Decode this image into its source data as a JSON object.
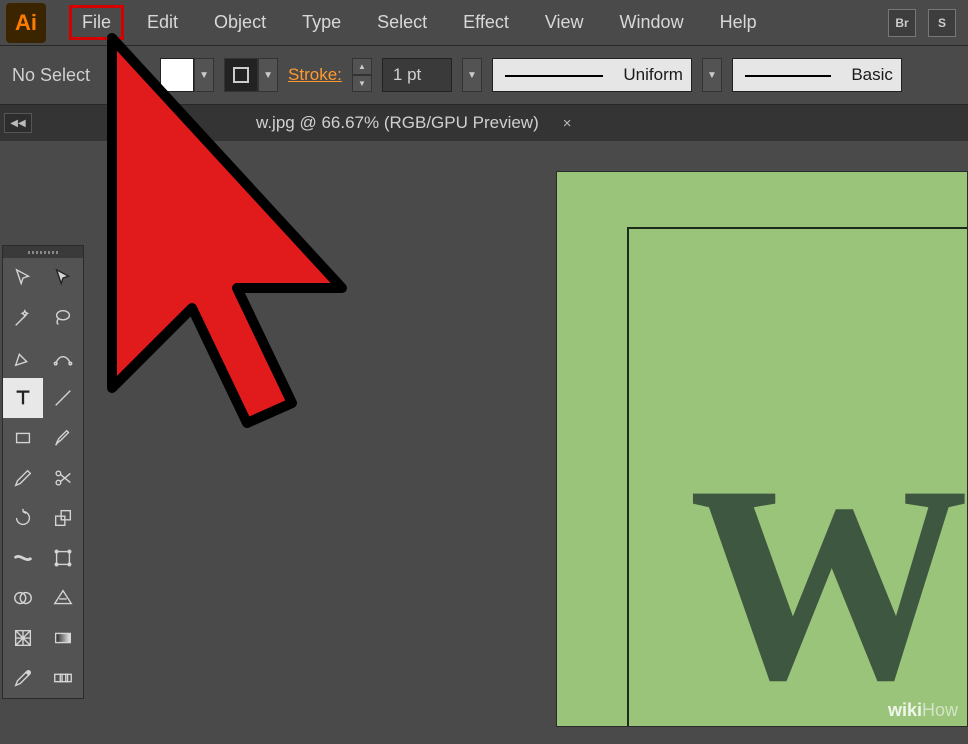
{
  "app": {
    "logo": "Ai"
  },
  "menu": {
    "items": [
      "File",
      "Edit",
      "Object",
      "Type",
      "Select",
      "Effect",
      "View",
      "Window",
      "Help"
    ],
    "highlighted_index": 0,
    "right_icons": [
      "Br",
      "S"
    ]
  },
  "controlbar": {
    "no_selection": "No Select",
    "stroke_label": "Stroke:",
    "stroke_value": "1 pt",
    "line_profile": "Uniform",
    "brush_profile": "Basic"
  },
  "tab": {
    "title": "w.jpg @ 66.67% (RGB/GPU Preview)",
    "close": "×"
  },
  "tools": [
    [
      "selection",
      "direct-selection"
    ],
    [
      "magic-wand",
      "lasso"
    ],
    [
      "pen",
      "curvature-pen"
    ],
    [
      "type",
      "line-segment"
    ],
    [
      "rectangle",
      "paintbrush"
    ],
    [
      "pencil",
      "scissors"
    ],
    [
      "rotate",
      "scale"
    ],
    [
      "width",
      "free-transform"
    ],
    [
      "shape-builder",
      "perspective-grid"
    ],
    [
      "mesh",
      "gradient"
    ],
    [
      "eyedropper",
      "blend"
    ]
  ],
  "tools_active": "type",
  "canvas": {
    "big_letter": "W"
  },
  "watermark": {
    "brand": "wiki",
    "suffix": "How"
  }
}
